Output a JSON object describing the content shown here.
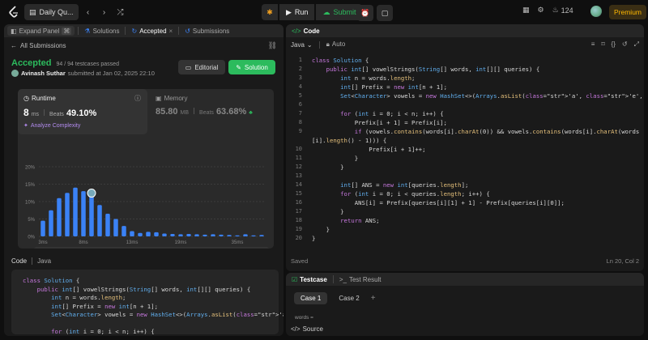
{
  "topbar": {
    "problem_tab": "Daily Qu...",
    "run_label": "Run",
    "submit_label": "Submit",
    "coins": "124",
    "premium_label": "Premium"
  },
  "left_tabs": {
    "expand_panel": "Expand Panel",
    "shortcut": "⌘",
    "solutions": "Solutions",
    "accepted": "Accepted",
    "submissions": "Submissions"
  },
  "submission": {
    "back_label": "All Submissions",
    "status": "Accepted",
    "testcases": "94 / 94 testcases passed",
    "user": "Avinash Suthar",
    "submitted": "submitted at Jan 02, 2025 22:10",
    "editorial_label": "Editorial",
    "solution_label": "Solution"
  },
  "stats": {
    "runtime_label": "Runtime",
    "runtime_value": "8",
    "runtime_unit": "ms",
    "beats_label": "Beats",
    "runtime_beats": "49.10%",
    "analyze_label": "Analyze Complexity",
    "memory_label": "Memory",
    "memory_value": "85.80",
    "memory_unit": "MB",
    "memory_beats": "63.68%"
  },
  "chart_data": {
    "type": "bar",
    "yticks": [
      "20%",
      "15%",
      "10%",
      "5%",
      "0%"
    ],
    "ylim": [
      0,
      20
    ],
    "xticks": [
      "3ms",
      "8ms",
      "13ms",
      "19ms",
      "35ms"
    ],
    "values": [
      4.5,
      7.5,
      11,
      12.5,
      14,
      13,
      11.5,
      9,
      6.5,
      5,
      3,
      1.5,
      1,
      1.3,
      1.2,
      0.8,
      0.7,
      0.6,
      0.7,
      0.6,
      0.5,
      0.6,
      0.5,
      0.4,
      0.3,
      0.6,
      0.3,
      0.4
    ],
    "highlight_index": 6,
    "minimap_xticks": [
      "3ms",
      "8ms",
      "13ms",
      "19ms",
      "35ms"
    ]
  },
  "code_panel": {
    "code_label": "Code",
    "lang_label": "Java"
  },
  "left_code": [
    "class Solution {",
    "    public int[] vowelStrings(String[] words, int[][] queries) {",
    "        int n = words.length;",
    "        int[] Prefix = new int[n + 1];",
    "        Set<Character> vowels = new HashSet<>(Arrays.asList('a', 'e', 'i",
    "",
    "        for (int i = 0; i < n; i++) {"
  ],
  "editor": {
    "title": "Code",
    "lang": "Java",
    "auto": "Auto",
    "saved": "Saved",
    "cursor": "Ln 20, Col 2",
    "lines": [
      "class Solution {",
      "    public int[] vowelStrings(String[] words, int[][] queries) {",
      "        int n = words.length;",
      "        int[] Prefix = new int[n + 1];",
      "        Set<Character> vowels = new HashSet<>(Arrays.asList('a', 'e', 'i', 'o', 'u'));",
      "",
      "        for (int i = 0; i < n; i++) {",
      "            Prefix[i + 1] = Prefix[i];",
      "            if (vowels.contains(words[i].charAt(0)) && vowels.contains(words[i].charAt(words",
      "[i].length() - 1))) {",
      "                Prefix[i + 1]++;",
      "            }",
      "        }",
      "",
      "        int[] ANS = new int[queries.length];",
      "        for (int i = 0; i < queries.length; i++) {",
      "            ANS[i] = Prefix[queries[i][1] + 1] - Prefix[queries[i][0]];",
      "        }",
      "        return ANS;",
      "    }",
      "}"
    ],
    "line_numbers": [
      "1",
      "2",
      "3",
      "4",
      "5",
      "6",
      "7",
      "8",
      "9",
      "",
      "10",
      "11",
      "12",
      "13",
      "14",
      "15",
      "16",
      "17",
      "18",
      "19",
      "20"
    ]
  },
  "testcase": {
    "tab1": "Testcase",
    "tab2": "Test Result",
    "case1": "Case 1",
    "case2": "Case 2",
    "add": "+",
    "input_label": "words =",
    "source_label": "Source"
  }
}
